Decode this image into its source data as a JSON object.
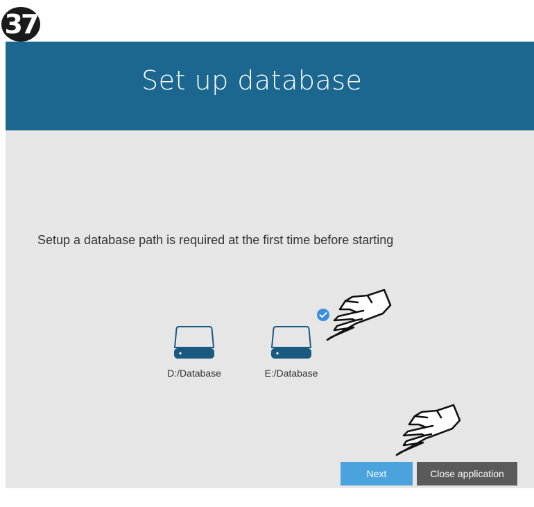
{
  "step": {
    "number": "37"
  },
  "window": {
    "title": "Set up database",
    "instruction": "Setup a database path is required at the first time before starting"
  },
  "drives": [
    {
      "label": "D:/Database",
      "selected": false
    },
    {
      "label": "E:/Database",
      "selected": true
    }
  ],
  "buttons": {
    "next": "Next",
    "close": "Close application"
  },
  "colors": {
    "header": "#1b6790",
    "panel": "#e6e6e6",
    "drive_icon": "#1b5a80",
    "next_button": "#4aa3dc",
    "close_button": "#5a5a5a",
    "check": "#3a8fdc"
  },
  "icons": [
    "hard-drive-icon",
    "check-circle-icon",
    "pointing-hand-icon"
  ]
}
